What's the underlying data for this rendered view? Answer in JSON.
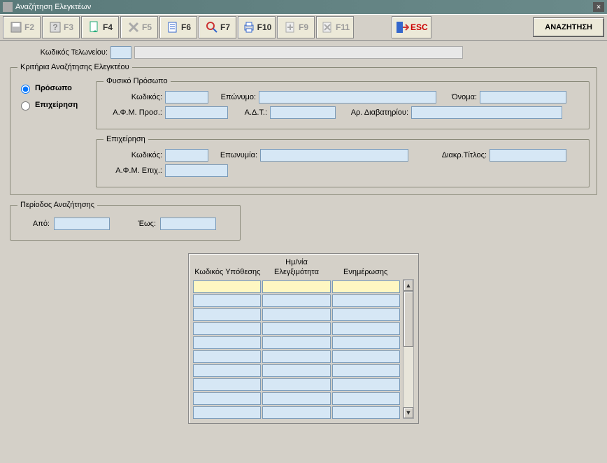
{
  "window": {
    "title": "Αναζήτηση Ελεγκτέων"
  },
  "toolbar": {
    "f2": "F2",
    "f3": "F3",
    "f4": "F4",
    "f5": "F5",
    "f6": "F6",
    "f7": "F7",
    "f10": "F10",
    "f9": "F9",
    "f11": "F11",
    "esc": "ESC",
    "search": "ΑΝΑΖΗΤΗΣΗ"
  },
  "customs": {
    "label": "Κωδικός Τελωνείου:",
    "code": "",
    "desc": ""
  },
  "criteria": {
    "legend": "Κριτήρια Αναζήτησης Ελεγκτέου",
    "radio_person": "Πρόσωπο",
    "radio_company": "Επιχείρηση",
    "person": {
      "legend": "Φυσικό Πρόσωπο",
      "code_lbl": "Κωδικός:",
      "code": "",
      "surname_lbl": "Επώνυμο:",
      "surname": "",
      "name_lbl": "Όνομα:",
      "name": "",
      "afm_lbl": "Α.Φ.Μ. Προσ.:",
      "afm": "",
      "adt_lbl": "Α.Δ.Τ.:",
      "adt": "",
      "passport_lbl": "Αρ. Διαβατηρίου:",
      "passport": ""
    },
    "company": {
      "legend": "Επιχείρηση",
      "code_lbl": "Κωδικός:",
      "code": "",
      "name_lbl": "Επωνυμία:",
      "name": "",
      "title_lbl": "Διακρ.Τίτλος:",
      "title": "",
      "afm_lbl": "Α.Φ.Μ. Επιχ.:",
      "afm": ""
    }
  },
  "period": {
    "legend": "Περίοδος Αναζήτησης",
    "from_lbl": "Από:",
    "from": "",
    "to_lbl": "Έως:",
    "to": ""
  },
  "table": {
    "col1": "Κωδικός Υπόθεσης",
    "col2": "Ελεγξιμότητα",
    "col3_line1": "Ημ/νία",
    "col3_line2": "Ενημέρωσης",
    "rows": [
      {
        "c1": "",
        "c2": "",
        "c3": ""
      },
      {
        "c1": "",
        "c2": "",
        "c3": ""
      },
      {
        "c1": "",
        "c2": "",
        "c3": ""
      },
      {
        "c1": "",
        "c2": "",
        "c3": ""
      },
      {
        "c1": "",
        "c2": "",
        "c3": ""
      },
      {
        "c1": "",
        "c2": "",
        "c3": ""
      },
      {
        "c1": "",
        "c2": "",
        "c3": ""
      },
      {
        "c1": "",
        "c2": "",
        "c3": ""
      },
      {
        "c1": "",
        "c2": "",
        "c3": ""
      },
      {
        "c1": "",
        "c2": "",
        "c3": ""
      }
    ]
  }
}
